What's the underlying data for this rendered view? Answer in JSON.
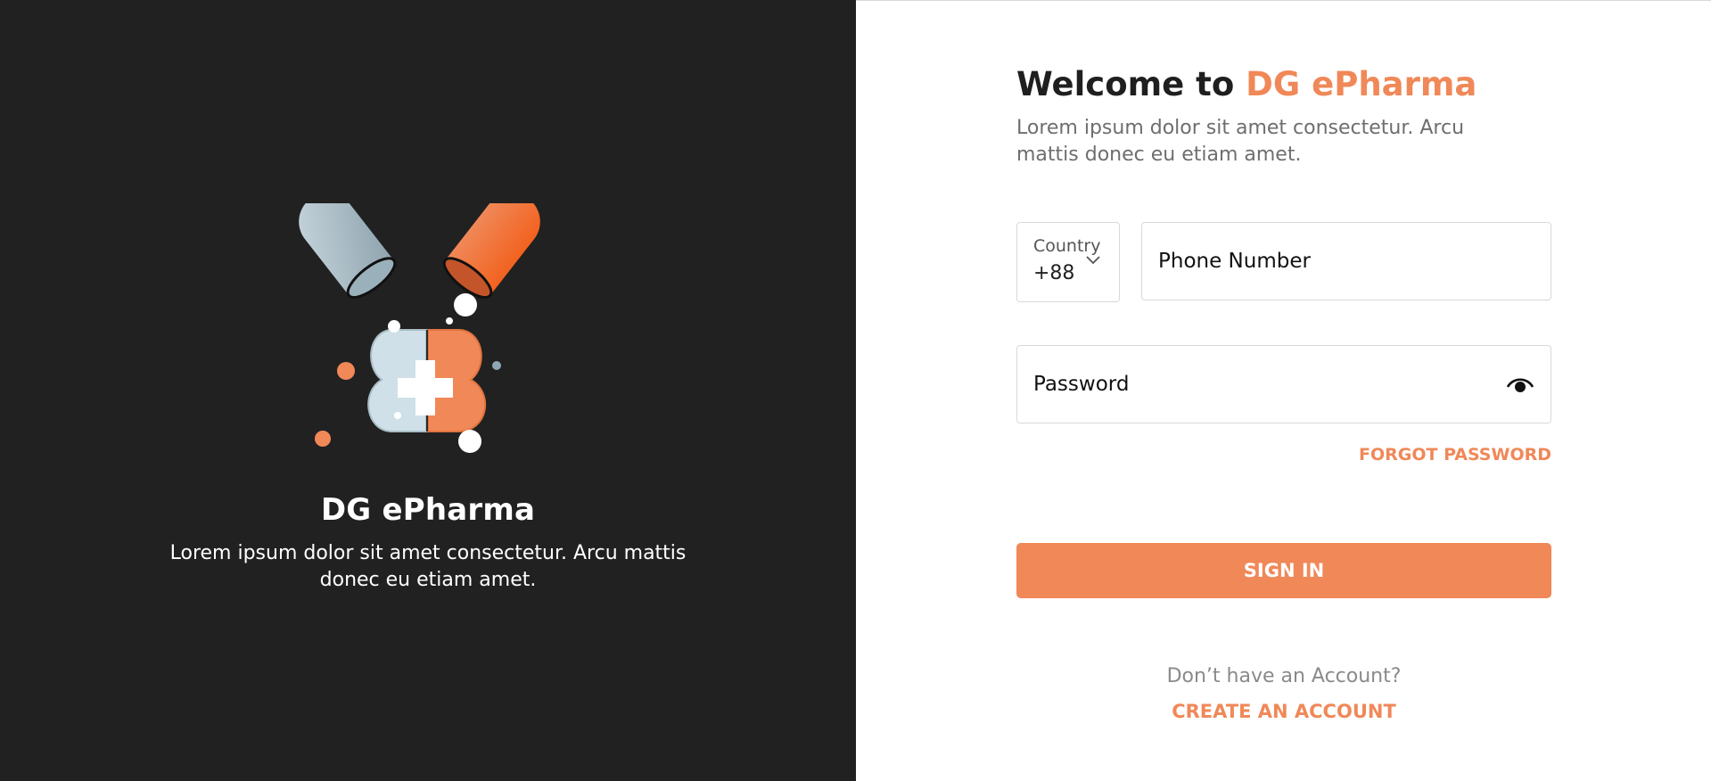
{
  "left": {
    "brand_name": "DG ePharma",
    "description": "Lorem ipsum dolor sit amet consectetur. Arcu mattis donec eu etiam amet."
  },
  "welcome": {
    "prefix": "Welcome to ",
    "brand": "DG ePharma",
    "description": "Lorem ipsum dolor sit amet consectetur. Arcu mattis donec eu etiam amet."
  },
  "form": {
    "country_label": "Country",
    "country_code": "+88",
    "phone_placeholder": "Phone Number",
    "password_placeholder": "Password",
    "forgot_password": "FORGOT PASSWORD",
    "sign_in": "SIGN IN",
    "no_account": "Don’t have an Account?",
    "create_account": "CREATE AN ACCOUNT"
  },
  "icons": {
    "chevron": "chevron-down-icon",
    "eye": "eye-icon",
    "illustration": "pharmacy-capsule-illustration"
  },
  "colors": {
    "accent": "#f08858",
    "dark_panel": "#212121",
    "capsule_light": "#c9d8df",
    "capsule_orange": "#f06a2e"
  }
}
